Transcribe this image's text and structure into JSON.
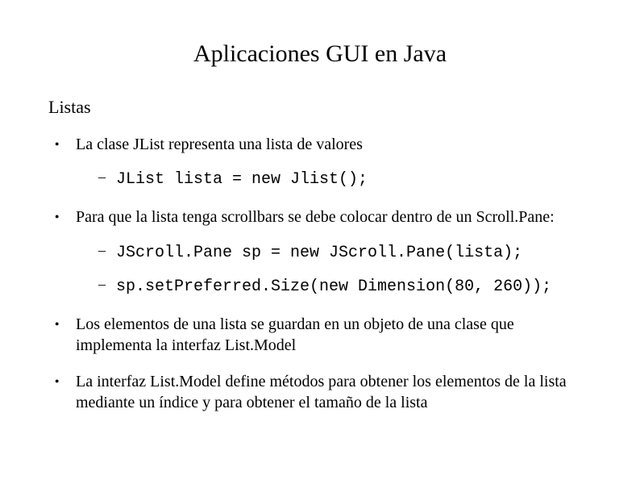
{
  "title": "Aplicaciones GUI en Java",
  "subtitle": "Listas",
  "bullets": [
    {
      "text": "La clase JList representa una lista de valores",
      "sub": [
        {
          "code": "JList lista = new Jlist();"
        }
      ]
    },
    {
      "text": "Para que la lista tenga scrollbars se debe colocar dentro de un Scroll.Pane:",
      "sub": [
        {
          "code": "JScroll.Pane sp = new JScroll.Pane(lista);"
        },
        {
          "code": "sp.setPreferred.Size(new Dimension(80, 260));"
        }
      ]
    },
    {
      "text": "Los elementos de una lista se guardan en un objeto de una clase que implementa la interfaz List.Model",
      "sub": []
    },
    {
      "text": "La interfaz List.Model define métodos para obtener los elementos de la lista mediante un índice y para obtener el tamaño de la lista",
      "sub": []
    }
  ]
}
